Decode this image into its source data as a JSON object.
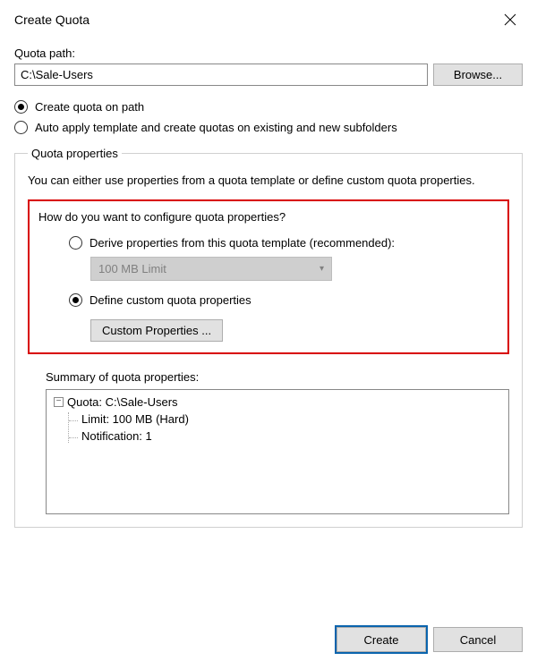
{
  "window": {
    "title": "Create Quota"
  },
  "quota_path": {
    "label": "Quota path:",
    "value": "C:\\Sale-Users",
    "browse": "Browse..."
  },
  "create_on_path": "Create quota on path",
  "auto_apply": "Auto apply template and create quotas on existing and new subfolders",
  "group": {
    "legend": "Quota properties",
    "desc": "You can either use properties from a quota template or define custom quota properties.",
    "question": "How do you want to configure quota properties?",
    "derive": "Derive properties from this quota template (recommended):",
    "template_selected": "100 MB Limit",
    "define": "Define custom quota properties",
    "custom_btn": "Custom Properties ...",
    "summary_label": "Summary of quota properties:",
    "tree": {
      "root": "Quota: C:\\Sale-Users",
      "limit": "Limit: 100 MB (Hard)",
      "notification": "Notification: 1"
    }
  },
  "buttons": {
    "create": "Create",
    "cancel": "Cancel"
  }
}
